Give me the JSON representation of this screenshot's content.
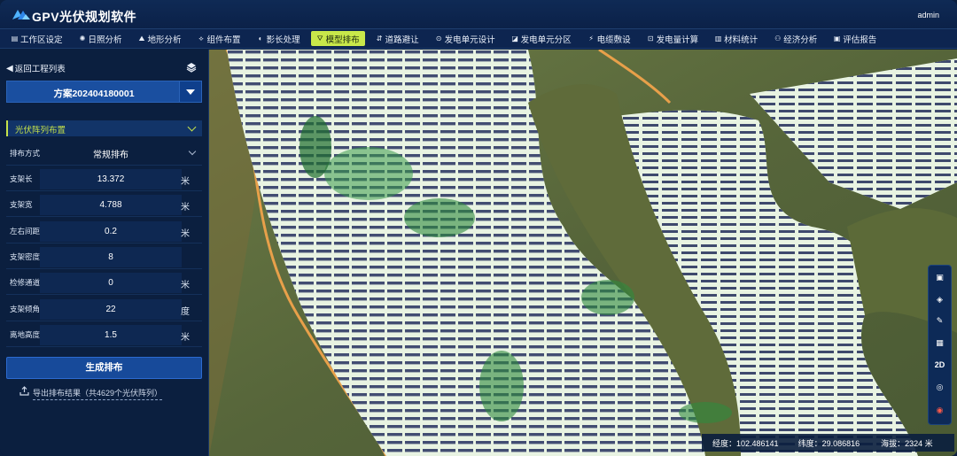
{
  "app": {
    "title": "GPV光伏规划软件",
    "user": "admin"
  },
  "toolbar": [
    {
      "label": "工作区设定",
      "icon": "workspace-icon"
    },
    {
      "label": "日照分析",
      "icon": "sun-icon"
    },
    {
      "label": "地形分析",
      "icon": "terrain-icon"
    },
    {
      "label": "组件布置",
      "icon": "component-icon"
    },
    {
      "label": "影长处理",
      "icon": "shadow-icon"
    },
    {
      "label": "模型排布",
      "icon": "model-icon"
    },
    {
      "label": "道路避让",
      "icon": "road-icon"
    },
    {
      "label": "发电单元设计",
      "icon": "unit-icon"
    },
    {
      "label": "发电单元分区",
      "icon": "partition-icon"
    },
    {
      "label": "电缆敷设",
      "icon": "cable-icon"
    },
    {
      "label": "发电量计算",
      "icon": "power-icon"
    },
    {
      "label": "材料统计",
      "icon": "stats-icon"
    },
    {
      "label": "经济分析",
      "icon": "economy-icon"
    },
    {
      "label": "评估报告",
      "icon": "report-icon"
    }
  ],
  "sidebar": {
    "back_label": "返回工程列表",
    "plan": "方案202404180001",
    "section_title": "光伏阵列布置",
    "params": [
      {
        "label": "排布方式",
        "value": "常规排布",
        "unit": "",
        "dropdown": true
      },
      {
        "label": "支架长",
        "value": "13.372",
        "unit": "米"
      },
      {
        "label": "支架宽",
        "value": "4.788",
        "unit": "米"
      },
      {
        "label": "左右间距",
        "value": "0.2",
        "unit": "米"
      },
      {
        "label": "支架密度",
        "value": "8",
        "unit": ""
      },
      {
        "label": "检修通道宽度",
        "value": "0",
        "unit": "米"
      },
      {
        "label": "支架倾角",
        "value": "22",
        "unit": "度"
      },
      {
        "label": "离地高度",
        "value": "1.5",
        "unit": "米"
      }
    ],
    "generate_label": "生成排布",
    "export_label": "导出排布结果（共4629个光伏阵列）"
  },
  "map_tools": [
    "select",
    "layers",
    "measure",
    "extent",
    "2D",
    "locate",
    "compass"
  ],
  "map_tools_text": {
    "mode": "2D"
  },
  "status": {
    "lon_label": "经度：",
    "lon": "102.486141",
    "lat_label": "纬度：",
    "lat": "29.086816",
    "alt_label": "海拔：",
    "alt": "2324 米"
  },
  "colors": {
    "accent": "#c8e84a",
    "panel": "#0b1f3f",
    "button": "#174a9a"
  }
}
